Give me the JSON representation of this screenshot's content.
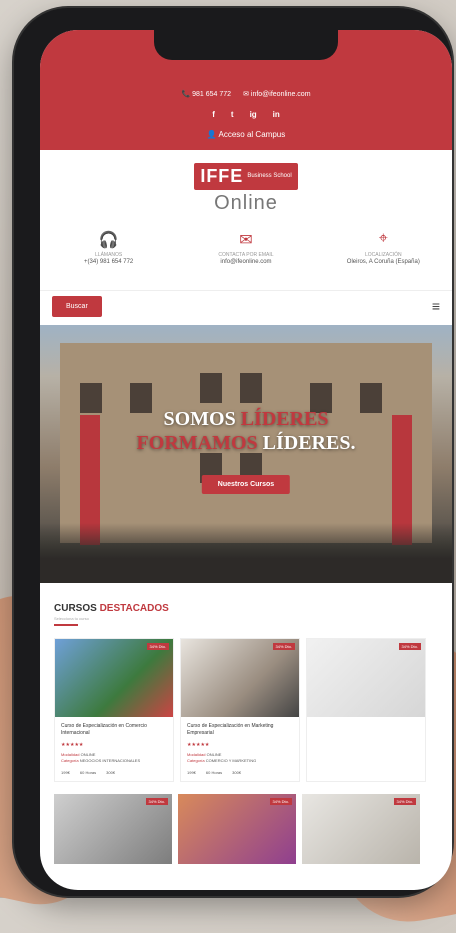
{
  "topbar": {
    "phone": "981 654 772",
    "email": "info@ifeonline.com",
    "social": [
      "f",
      "t",
      "ig",
      "in"
    ],
    "access": "Acceso al Campus"
  },
  "logo": {
    "brand": "IFFE",
    "subtitle": "Business School",
    "online": "Online"
  },
  "info": [
    {
      "icon": "headset-icon",
      "title": "LLÁMANOS",
      "value": "+(34) 981 654 772"
    },
    {
      "icon": "mail-icon",
      "title": "CONTACTA POR EMAIL",
      "value": "info@ifeonline.com"
    },
    {
      "icon": "location-pin-icon",
      "title": "LOCALIZACIÓN",
      "value": "Oleiros, A Coruña (España)"
    }
  ],
  "nav": {
    "search_button": "Buscar"
  },
  "hero": {
    "line1_a": "SOMOS ",
    "line1_b": "LÍDERES",
    "line2_a": "FORMAMOS ",
    "line2_b": "LÍDERES.",
    "cta": "Nuestros Cursos"
  },
  "featured": {
    "title_a": "CURSOS ",
    "title_b": "DESTACADOS",
    "subtitle": "Selecciona tu curso"
  },
  "courses": [
    {
      "badge": "34% Dto.",
      "title": "Curso de Especialización en Comercio Internacional",
      "modalidad": "ONLINE",
      "categoria": "NEGOCIOS INTERNACIONALES",
      "price": "199€",
      "hours": "60 Horas",
      "plazo": "300€"
    },
    {
      "badge": "34% Dto.",
      "title": "Curso de Especialización en Marketing Empresarial",
      "modalidad": "ONLINE",
      "categoria": "COMERCIO Y MARKETING",
      "price": "199€",
      "hours": "60 Horas",
      "plazo": "300€"
    },
    {
      "badge": "34% Dto.",
      "title": "",
      "modalidad": "",
      "categoria": "",
      "price": "",
      "hours": "",
      "plazo": ""
    }
  ],
  "courses2": [
    {
      "badge": "34% Dto."
    },
    {
      "badge": "34% Dto."
    },
    {
      "badge": "34% Dto."
    }
  ],
  "colors": {
    "accent": "#c0393f"
  }
}
